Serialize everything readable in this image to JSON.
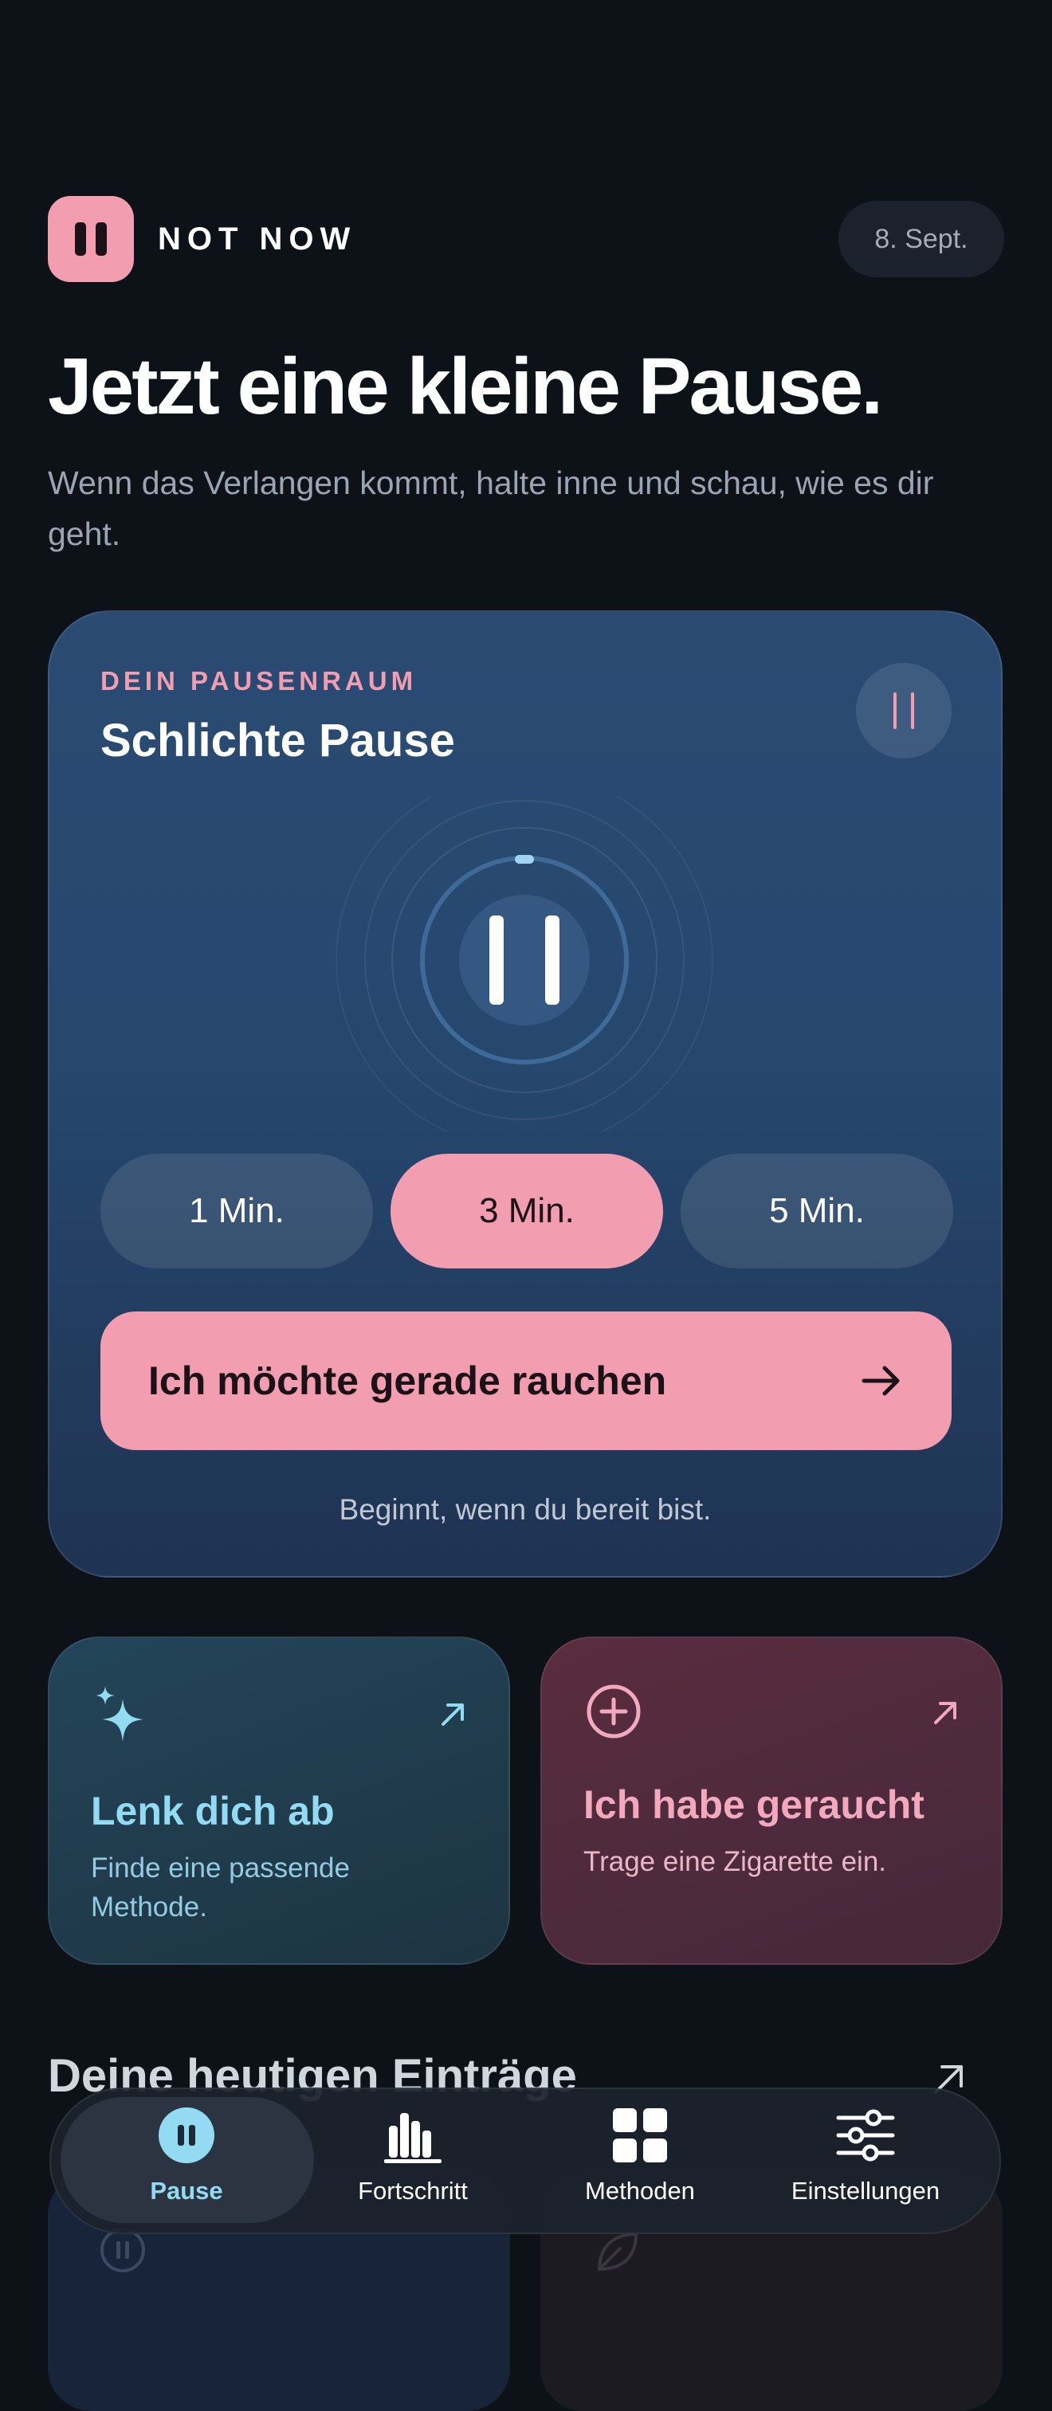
{
  "header": {
    "brand": "NOT NOW",
    "date": "8. Sept."
  },
  "hero": {
    "title": "Jetzt eine kleine Pause.",
    "subtitle": "Wenn das Verlangen kommt, halte inne und schau, wie es dir geht."
  },
  "pause_card": {
    "eyebrow": "DEIN PAUSENRAUM",
    "title": "Schlichte Pause",
    "durations": [
      "1 Min.",
      "3 Min.",
      "5 Min."
    ],
    "selected_duration": "3 Min.",
    "cta_label": "Ich möchte gerade rauchen",
    "hint": "Beginnt, wenn du bereit bist."
  },
  "quick_actions": [
    {
      "title": "Lenk dich ab",
      "subtitle": "Finde eine passende Methode.",
      "icon": "sparkles-icon"
    },
    {
      "title": "Ich habe geraucht",
      "subtitle": "Trage eine Zigarette ein.",
      "icon": "plus-circle-icon"
    }
  ],
  "today": {
    "heading": "Deine heutigen Einträge"
  },
  "tabs": [
    {
      "label": "Pause",
      "icon": "pause-icon",
      "active": true
    },
    {
      "label": "Fortschritt",
      "icon": "bar-chart-icon",
      "active": false
    },
    {
      "label": "Methoden",
      "icon": "grid-icon",
      "active": false
    },
    {
      "label": "Einstellungen",
      "icon": "sliders-icon",
      "active": false
    }
  ],
  "colors": {
    "background": "#0d1219",
    "accent_pink": "#f29db0",
    "accent_cyan": "#93dbf2",
    "card_blue": "#26486f"
  }
}
